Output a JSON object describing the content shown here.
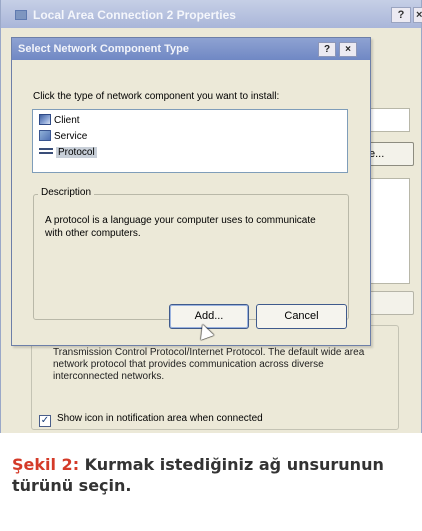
{
  "background_window": {
    "title": "Local Area Connection 2 Properties",
    "help_glyph": "?",
    "close_glyph": "×",
    "button_label": "e...",
    "description": "Transmission Control Protocol/Internet Protocol. The default wide area network protocol that provides communication across diverse interconnected networks.",
    "checkbox_label": "Show icon in notification area when connected",
    "checkbox_glyph": "✓"
  },
  "dialog": {
    "title": "Select Network Component Type",
    "help_glyph": "?",
    "close_glyph": "×",
    "instruction": "Click the type of network component you want to install:",
    "items": [
      {
        "label": "Client",
        "icon": "client-icon"
      },
      {
        "label": "Service",
        "icon": "service-icon"
      },
      {
        "label": "Protocol",
        "icon": "protocol-icon",
        "selected": true
      }
    ],
    "description_legend": "Description",
    "description_text": "A protocol is a language your computer uses to communicate with other computers.",
    "add_label": "Add...",
    "cancel_label": "Cancel"
  },
  "caption": {
    "label": "Şekil 2:",
    "text": " Kurmak istediğiniz ağ unsurunun türünü seçin."
  },
  "colors": {
    "caption_accent": "#d43a28",
    "title_bar": "#7088c4",
    "dialog_face": "#ece9d8"
  }
}
